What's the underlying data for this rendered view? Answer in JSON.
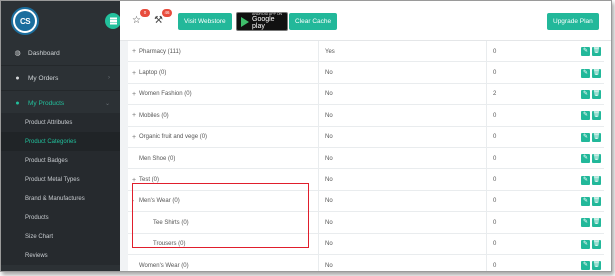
{
  "app": {
    "logo_text": "CS"
  },
  "sidebar": {
    "items": [
      {
        "label": "Dashboard",
        "icon": "dashboard-icon",
        "glyph": "◍"
      },
      {
        "label": "My Orders",
        "icon": "user-icon",
        "glyph": "●"
      },
      {
        "label": "My Products",
        "icon": "user-icon",
        "glyph": "●"
      }
    ],
    "subitems": [
      {
        "label": "Product Attributes"
      },
      {
        "label": "Product Categories"
      },
      {
        "label": "Product Badges"
      },
      {
        "label": "Product Metal Types"
      },
      {
        "label": "Brand & Manufactures"
      },
      {
        "label": "Products"
      },
      {
        "label": "Size Chart"
      },
      {
        "label": "Reviews"
      }
    ],
    "active_subitem": "Product Categories"
  },
  "topbar": {
    "star_badge": "0",
    "hammer_badge": "46",
    "visit_webstore_label": "Visit Webstore",
    "gplay_small": "ANDROID APP ON",
    "gplay_big": "Google play",
    "clear_cache_label": "Clear Cache",
    "upgrade_label": "Upgrade Plan"
  },
  "colors": {
    "accent": "#22b89a",
    "sidebar_bg": "#2c3135",
    "highlight": "#e01e2c"
  },
  "table": {
    "rows": [
      {
        "prefix": "+",
        "name": "Pharmacy (111)",
        "status": "Yes",
        "count": "0"
      },
      {
        "prefix": "+",
        "name": "Laptop (0)",
        "status": "No",
        "count": "0"
      },
      {
        "prefix": "+",
        "name": "Women Fashion (0)",
        "status": "No",
        "count": "2"
      },
      {
        "prefix": "+",
        "name": "Mobiles (0)",
        "status": "No",
        "count": "0"
      },
      {
        "prefix": "+",
        "name": "Organic fruit and vege (0)",
        "status": "No",
        "count": "0"
      },
      {
        "prefix": "",
        "name": "Men Shoe (0)",
        "status": "No",
        "count": "0"
      },
      {
        "prefix": "+",
        "name": "Test (0)",
        "status": "No",
        "count": "0"
      },
      {
        "prefix": "-",
        "name": "Men's Wear (0)",
        "status": "No",
        "count": "0"
      },
      {
        "prefix": "",
        "name": "Tee Shirts (0)",
        "status": "No",
        "count": "0",
        "indent": true
      },
      {
        "prefix": "",
        "name": "Trousers (0)",
        "status": "No",
        "count": "0",
        "indent": true
      },
      {
        "prefix": "",
        "name": "Women's Wear (0)",
        "status": "No",
        "count": "0"
      }
    ]
  }
}
